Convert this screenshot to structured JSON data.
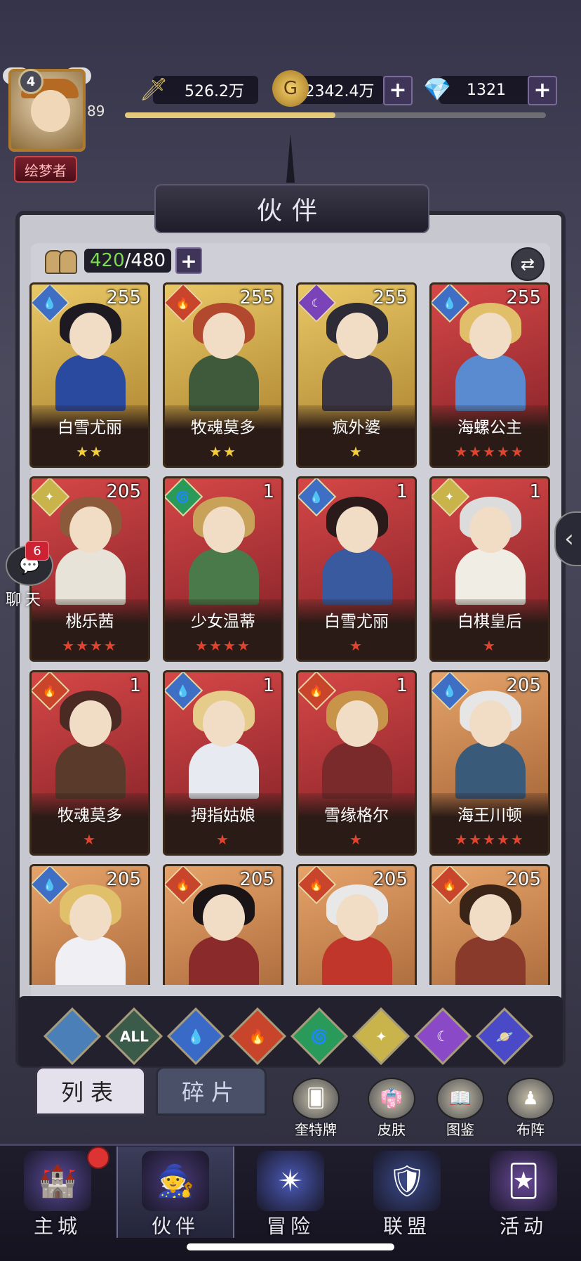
{
  "header": {
    "player_level": "4",
    "player_exp_level": "89",
    "player_title": "绘梦者",
    "resources": [
      {
        "icon": "sword-power-icon",
        "value": "526.2万"
      },
      {
        "icon": "gold-coin-icon",
        "value": "2342.4万"
      },
      {
        "icon": "diamond-icon",
        "value": "1321"
      }
    ],
    "exp_progress": 0.5
  },
  "panel": {
    "title": "伙伴",
    "count_current": "420",
    "count_separator": "/480"
  },
  "cards": [
    {
      "name": "白雪尤丽",
      "level": "255",
      "element": "water",
      "frame": "gold",
      "stars": "★★",
      "star_color": "y",
      "hair": "#1d1a22",
      "body": "#2a4aa0"
    },
    {
      "name": "牧魂莫多",
      "level": "255",
      "element": "fire",
      "frame": "gold",
      "stars": "★★",
      "star_color": "y",
      "hair": "#b2492e",
      "body": "#3f5a3a"
    },
    {
      "name": "疯外婆",
      "level": "255",
      "element": "moon",
      "frame": "gold",
      "stars": "★",
      "star_color": "y",
      "hair": "#2c2b36",
      "body": "#3a3646"
    },
    {
      "name": "海螺公主",
      "level": "255",
      "element": "water",
      "frame": "red",
      "stars": "★★★★★",
      "star_color": "r",
      "hair": "#e0be6a",
      "body": "#5a8ad0"
    },
    {
      "name": "桃乐茜",
      "level": "205",
      "element": "light",
      "frame": "red",
      "stars": "★★★★",
      "star_color": "r",
      "hair": "#8a5a3a",
      "body": "#e8e3d8"
    },
    {
      "name": "少女温蒂",
      "level": "1",
      "element": "wind",
      "frame": "red",
      "stars": "★★★★",
      "star_color": "r",
      "hair": "#c9a25a",
      "body": "#4a7a4a"
    },
    {
      "name": "白雪尤丽",
      "level": "1",
      "element": "water",
      "frame": "red",
      "stars": "★",
      "star_color": "r",
      "hair": "#2a1a1a",
      "body": "#3a5aa0"
    },
    {
      "name": "白棋皇后",
      "level": "1",
      "element": "light",
      "frame": "red",
      "stars": "★",
      "star_color": "r",
      "hair": "#dcdcdc",
      "body": "#f0ede4"
    },
    {
      "name": "牧魂莫多",
      "level": "1",
      "element": "fire",
      "frame": "red",
      "stars": "★",
      "star_color": "r",
      "hair": "#4a2a22",
      "body": "#5a3a2a"
    },
    {
      "name": "拇指姑娘",
      "level": "1",
      "element": "water",
      "frame": "red",
      "stars": "★",
      "star_color": "r",
      "hair": "#e6cc8a",
      "body": "#e8eaf2"
    },
    {
      "name": "雪缘格尔",
      "level": "1",
      "element": "fire",
      "frame": "red",
      "stars": "★",
      "star_color": "r",
      "hair": "#c8944a",
      "body": "#7a2a2a"
    },
    {
      "name": "海王川顿",
      "level": "205",
      "element": "water",
      "frame": "orange",
      "stars": "★★★★★",
      "star_color": "r",
      "hair": "#e6e6e6",
      "body": "#3a5a7a"
    },
    {
      "name": "",
      "level": "205",
      "element": "water",
      "frame": "orange",
      "stars": "",
      "star_color": "r",
      "hair": "#e0c06a",
      "body": "#f0f0f4"
    },
    {
      "name": "",
      "level": "205",
      "element": "fire",
      "frame": "orange",
      "stars": "",
      "star_color": "r",
      "hair": "#1a1416",
      "body": "#8a2a2a"
    },
    {
      "name": "",
      "level": "205",
      "element": "fire",
      "frame": "orange",
      "stars": "",
      "star_color": "r",
      "hair": "#e8e8e8",
      "body": "#c0362a"
    },
    {
      "name": "",
      "level": "205",
      "element": "fire",
      "frame": "orange",
      "stars": "",
      "star_color": "r",
      "hair": "#3a2418",
      "body": "#8a3a2a"
    }
  ],
  "filters": [
    {
      "name": "filter-class",
      "label": "",
      "color": "#4a7fb8"
    },
    {
      "name": "filter-all",
      "label": "ALL",
      "color": "#3a5a4a"
    },
    {
      "name": "filter-water",
      "label": "💧",
      "color": "#3a6ac8"
    },
    {
      "name": "filter-fire",
      "label": "🔥",
      "color": "#c8442a"
    },
    {
      "name": "filter-wind",
      "label": "🌀",
      "color": "#2a9a5a"
    },
    {
      "name": "filter-light",
      "label": "✦",
      "color": "#c8b44a"
    },
    {
      "name": "filter-moon",
      "label": "☾",
      "color": "#8a4ac8"
    },
    {
      "name": "filter-cosmos",
      "label": "🪐",
      "color": "#4a4ac8"
    }
  ],
  "tabs": {
    "list": "列表",
    "fragments": "碎片"
  },
  "shortcuts": [
    {
      "name": "tarot",
      "label": "奎特牌",
      "icon": "🂠"
    },
    {
      "name": "skin",
      "label": "皮肤",
      "icon": "👘"
    },
    {
      "name": "codex",
      "label": "图鉴",
      "icon": "📖"
    },
    {
      "name": "formation",
      "label": "布阵",
      "icon": "♟"
    }
  ],
  "nav": [
    {
      "name": "main-city",
      "label": "主城",
      "icon": "🏰"
    },
    {
      "name": "partners",
      "label": "伙伴",
      "icon": "🧙"
    },
    {
      "name": "adventure",
      "label": "冒险",
      "icon": "✴"
    },
    {
      "name": "alliance",
      "label": "联盟",
      "icon": "🛡"
    },
    {
      "name": "events",
      "label": "活动",
      "icon": "🃏"
    }
  ],
  "chat": {
    "badge": "6",
    "label": "聊天"
  },
  "element_icons": {
    "water": "💧",
    "fire": "🔥",
    "moon": "☾",
    "light": "✦",
    "wind": "🌀"
  },
  "element_colors": {
    "water": "#3f6fc4",
    "fire": "#c8442a",
    "moon": "#7a44b8",
    "light": "#c8b44a",
    "wind": "#2a9a5a"
  }
}
